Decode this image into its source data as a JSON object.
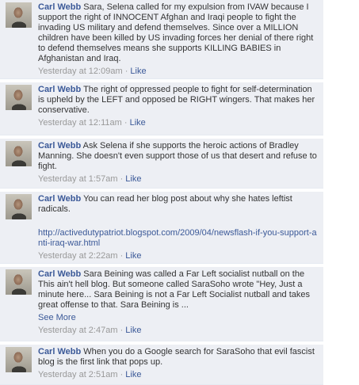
{
  "comments": [
    {
      "author": "Carl Webb",
      "text": "Sara, Selena called for my expulsion from IVAW because I support the right of INNOCENT Afghan and Iraqi people to fight the invading US military and defend themselves. Since over a MILLION children have been killed by US invading forces her denial of there right to defend themselves means she supports KILLING BABIES in Afghanistan and Iraq.",
      "timestamp": "Yesterday at 12:09am",
      "separator": "·",
      "like_label": "Like"
    },
    {
      "author": "Carl Webb",
      "text": "The right of oppressed people to fight for self-determination is upheld by the LEFT and opposed be RIGHT wingers. That makes her conservative.",
      "timestamp": "Yesterday at 12:11am",
      "separator": "·",
      "like_label": "Like"
    },
    {
      "author": "Carl Webb",
      "text": "Ask Selena if she supports the heroic actions of Bradley Manning. She doesn't even support those of us that desert and refuse to fight.",
      "timestamp": "Yesterday at 1:57am",
      "separator": "·",
      "like_label": "Like"
    },
    {
      "author": "Carl Webb",
      "text": "You can read her blog post about why she hates leftist radicals.",
      "link": "http://activedutypatriot.blogspot.com/2009/04/newsflash-if-you-support-anti-iraq-war.html",
      "timestamp": "Yesterday at 2:22am",
      "separator": "·",
      "like_label": "Like"
    },
    {
      "author": "Carl Webb",
      "text": "Sara Beining was called a Far Left socialist nutball on the This ain't hell blog. But someone called SaraSoho wrote \"Hey, Just a minute here... Sara Beining is not a Far Left Socialist nutball and takes great offense to that. Sara Beining is ...",
      "see_more": "See More",
      "timestamp": "Yesterday at 2:47am",
      "separator": "·",
      "like_label": "Like"
    },
    {
      "author": "Carl Webb",
      "text": "When you do a Google search for SaraSoho that evil fascist blog is the first link that pops up.",
      "timestamp": "Yesterday at 2:51am",
      "separator": "·",
      "like_label": "Like"
    }
  ]
}
